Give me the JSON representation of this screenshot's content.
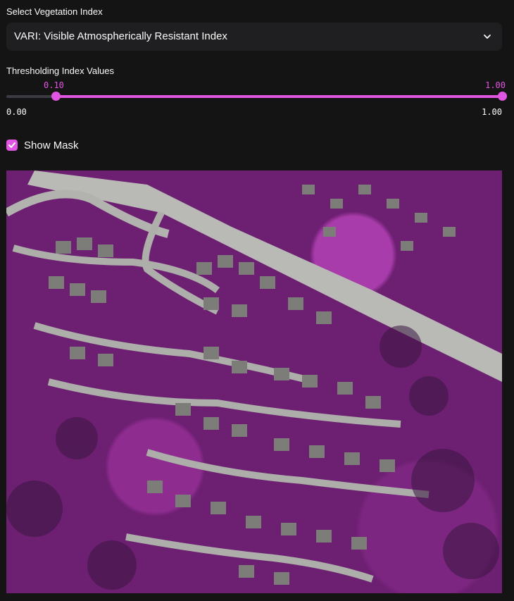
{
  "select": {
    "label": "Select Vegetation Index",
    "value": "VARI: Visible Atmospherically Resistant Index"
  },
  "slider": {
    "label": "Thresholding Index Values",
    "low": "0.10",
    "high": "1.00",
    "min": "0.00",
    "max": "1.00",
    "low_fraction": 0.1,
    "high_fraction": 1.0
  },
  "mask": {
    "label": "Show Mask",
    "checked": true
  },
  "colors": {
    "accent": "#e056e3",
    "background": "#141414",
    "select_bg": "#1f1f22",
    "mask_color": "#b63ab8"
  },
  "icons": {
    "dropdown": "chevron-down-icon",
    "check": "check-icon"
  }
}
